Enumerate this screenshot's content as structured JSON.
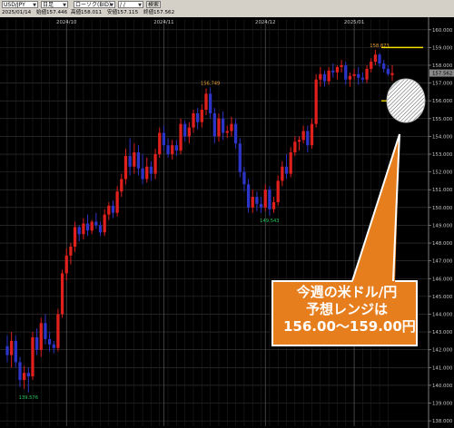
{
  "toolbar": {
    "symbol": "USD/JPY",
    "period": "日足",
    "chart_style": "ローソク(BID)",
    "date_input": "/ /",
    "search_button": "検索"
  },
  "ohlc": {
    "date": "2025/01/14",
    "open_label": "始値",
    "open": "157.446",
    "high_label": "高値",
    "high": "158.011",
    "low_label": "安値",
    "low": "157.115",
    "close_label": "終値",
    "close": "157.562"
  },
  "callout": {
    "line1": "今週の米ドル/円",
    "line2": "予想レンジは",
    "line3": "156.00〜159.00円"
  },
  "colors": {
    "background": "#000000",
    "up_candle": "#e0201c",
    "down_candle": "#2d35c8",
    "grid": "#3a3a3a",
    "axis_text": "#c8c8c8",
    "range_lines": "#f5e000",
    "callout_fill": "#e67e1e",
    "current_price_marker": "#8a8a8a"
  },
  "chart_data": {
    "type": "candlestick",
    "y_axis_ticks": [
      "160.000",
      "159.000",
      "158.000",
      "157.000",
      "156.000",
      "155.000",
      "154.000",
      "153.000",
      "152.000",
      "151.000",
      "150.000",
      "149.000",
      "148.000",
      "147.000",
      "146.000",
      "145.000",
      "144.000",
      "143.000",
      "142.000",
      "141.000",
      "140.000",
      "139.000",
      "138.000"
    ],
    "ylim": [
      137.7,
      160.6
    ],
    "month_labels": [
      {
        "label": "2024/10",
        "index": 14
      },
      {
        "label": "2024/11",
        "index": 37
      },
      {
        "label": "2024/12",
        "index": 61
      },
      {
        "label": "2025/01",
        "index": 82
      }
    ],
    "annotations": [
      {
        "text": "139.576",
        "index": 5,
        "value": 139.576
      },
      {
        "text": "156.749",
        "index": 48,
        "value": 156.749
      },
      {
        "text": "149.543",
        "index": 62,
        "value": 149.543
      },
      {
        "text": "158.873",
        "index": 88,
        "value": 158.873
      }
    ],
    "current_price": "157.562",
    "range_lines": [
      159.0,
      156.0
    ],
    "candles": [
      {
        "o": 142.2,
        "h": 142.8,
        "l": 141.3,
        "c": 141.7
      },
      {
        "o": 141.7,
        "h": 143.0,
        "l": 141.0,
        "c": 142.5
      },
      {
        "o": 142.5,
        "h": 142.8,
        "l": 141.0,
        "c": 141.3
      },
      {
        "o": 141.3,
        "h": 141.6,
        "l": 139.9,
        "c": 140.3
      },
      {
        "o": 140.3,
        "h": 141.1,
        "l": 139.8,
        "c": 140.7
      },
      {
        "o": 140.7,
        "h": 141.0,
        "l": 139.6,
        "c": 140.5
      },
      {
        "o": 140.5,
        "h": 143.0,
        "l": 140.3,
        "c": 142.7
      },
      {
        "o": 142.7,
        "h": 143.2,
        "l": 141.7,
        "c": 142.0
      },
      {
        "o": 142.0,
        "h": 143.8,
        "l": 141.6,
        "c": 143.5
      },
      {
        "o": 143.5,
        "h": 144.0,
        "l": 142.3,
        "c": 142.6
      },
      {
        "o": 142.6,
        "h": 143.0,
        "l": 141.9,
        "c": 142.3
      },
      {
        "o": 142.3,
        "h": 142.5,
        "l": 141.8,
        "c": 142.1
      },
      {
        "o": 142.1,
        "h": 144.3,
        "l": 141.9,
        "c": 144.0
      },
      {
        "o": 144.0,
        "h": 146.5,
        "l": 143.8,
        "c": 146.3
      },
      {
        "o": 146.3,
        "h": 147.7,
        "l": 145.9,
        "c": 147.3
      },
      {
        "o": 147.3,
        "h": 148.0,
        "l": 146.8,
        "c": 147.8
      },
      {
        "o": 147.8,
        "h": 149.2,
        "l": 147.5,
        "c": 148.9
      },
      {
        "o": 148.9,
        "h": 149.0,
        "l": 148.1,
        "c": 148.5
      },
      {
        "o": 148.5,
        "h": 149.4,
        "l": 148.2,
        "c": 149.1
      },
      {
        "o": 149.1,
        "h": 149.6,
        "l": 148.4,
        "c": 148.7
      },
      {
        "o": 148.7,
        "h": 149.3,
        "l": 148.5,
        "c": 149.2
      },
      {
        "o": 149.2,
        "h": 149.7,
        "l": 148.8,
        "c": 149.0
      },
      {
        "o": 149.0,
        "h": 149.2,
        "l": 148.4,
        "c": 148.6
      },
      {
        "o": 148.6,
        "h": 149.9,
        "l": 148.4,
        "c": 149.6
      },
      {
        "o": 149.6,
        "h": 150.3,
        "l": 149.3,
        "c": 150.1
      },
      {
        "o": 150.1,
        "h": 150.4,
        "l": 149.4,
        "c": 149.7
      },
      {
        "o": 149.7,
        "h": 151.2,
        "l": 149.5,
        "c": 150.9
      },
      {
        "o": 150.9,
        "h": 151.9,
        "l": 150.6,
        "c": 151.6
      },
      {
        "o": 151.6,
        "h": 153.3,
        "l": 151.3,
        "c": 152.9
      },
      {
        "o": 152.9,
        "h": 153.9,
        "l": 151.8,
        "c": 152.3
      },
      {
        "o": 152.3,
        "h": 153.6,
        "l": 151.9,
        "c": 153.1
      },
      {
        "o": 153.1,
        "h": 153.5,
        "l": 151.8,
        "c": 152.2
      },
      {
        "o": 152.2,
        "h": 153.0,
        "l": 151.3,
        "c": 151.6
      },
      {
        "o": 151.6,
        "h": 152.8,
        "l": 151.4,
        "c": 152.3
      },
      {
        "o": 152.3,
        "h": 152.6,
        "l": 151.5,
        "c": 151.9
      },
      {
        "o": 151.9,
        "h": 153.3,
        "l": 151.6,
        "c": 153.0
      },
      {
        "o": 153.0,
        "h": 154.5,
        "l": 152.8,
        "c": 154.2
      },
      {
        "o": 154.2,
        "h": 154.6,
        "l": 153.2,
        "c": 153.5
      },
      {
        "o": 153.5,
        "h": 153.9,
        "l": 152.8,
        "c": 153.0
      },
      {
        "o": 153.0,
        "h": 153.8,
        "l": 152.7,
        "c": 153.5
      },
      {
        "o": 153.5,
        "h": 153.8,
        "l": 152.9,
        "c": 153.2
      },
      {
        "o": 153.2,
        "h": 155.0,
        "l": 153.0,
        "c": 154.7
      },
      {
        "o": 154.7,
        "h": 154.9,
        "l": 153.7,
        "c": 154.0
      },
      {
        "o": 154.0,
        "h": 154.8,
        "l": 153.6,
        "c": 154.5
      },
      {
        "o": 154.5,
        "h": 155.5,
        "l": 154.2,
        "c": 155.3
      },
      {
        "o": 155.3,
        "h": 155.6,
        "l": 154.4,
        "c": 154.8
      },
      {
        "o": 154.8,
        "h": 155.8,
        "l": 154.5,
        "c": 155.5
      },
      {
        "o": 155.5,
        "h": 156.7,
        "l": 155.2,
        "c": 156.4
      },
      {
        "o": 156.4,
        "h": 156.749,
        "l": 155.0,
        "c": 155.3
      },
      {
        "o": 155.3,
        "h": 155.6,
        "l": 153.6,
        "c": 154.0
      },
      {
        "o": 154.0,
        "h": 155.3,
        "l": 153.7,
        "c": 155.0
      },
      {
        "o": 155.0,
        "h": 155.4,
        "l": 153.8,
        "c": 154.2
      },
      {
        "o": 154.2,
        "h": 154.6,
        "l": 153.9,
        "c": 154.3
      },
      {
        "o": 154.3,
        "h": 155.1,
        "l": 154.0,
        "c": 154.7
      },
      {
        "o": 154.7,
        "h": 155.0,
        "l": 153.3,
        "c": 153.6
      },
      {
        "o": 153.6,
        "h": 153.9,
        "l": 151.7,
        "c": 152.0
      },
      {
        "o": 152.0,
        "h": 152.3,
        "l": 150.9,
        "c": 151.3
      },
      {
        "o": 151.3,
        "h": 151.6,
        "l": 149.7,
        "c": 150.0
      },
      {
        "o": 150.0,
        "h": 151.0,
        "l": 149.7,
        "c": 150.6
      },
      {
        "o": 150.6,
        "h": 150.9,
        "l": 149.8,
        "c": 150.2
      },
      {
        "o": 150.2,
        "h": 150.6,
        "l": 149.7,
        "c": 150.0
      },
      {
        "o": 150.0,
        "h": 151.3,
        "l": 149.8,
        "c": 151.0
      },
      {
        "o": 151.0,
        "h": 151.2,
        "l": 149.543,
        "c": 149.9
      },
      {
        "o": 149.9,
        "h": 150.6,
        "l": 149.7,
        "c": 150.3
      },
      {
        "o": 150.3,
        "h": 151.8,
        "l": 150.1,
        "c": 151.5
      },
      {
        "o": 151.5,
        "h": 152.6,
        "l": 151.2,
        "c": 152.3
      },
      {
        "o": 152.3,
        "h": 153.0,
        "l": 151.6,
        "c": 151.9
      },
      {
        "o": 151.9,
        "h": 153.4,
        "l": 151.7,
        "c": 153.1
      },
      {
        "o": 153.1,
        "h": 154.0,
        "l": 152.9,
        "c": 153.7
      },
      {
        "o": 153.7,
        "h": 154.0,
        "l": 153.2,
        "c": 153.8
      },
      {
        "o": 153.8,
        "h": 154.6,
        "l": 153.6,
        "c": 154.3
      },
      {
        "o": 154.3,
        "h": 154.6,
        "l": 153.1,
        "c": 153.5
      },
      {
        "o": 153.5,
        "h": 155.0,
        "l": 153.3,
        "c": 154.7
      },
      {
        "o": 154.7,
        "h": 157.5,
        "l": 154.5,
        "c": 157.2
      },
      {
        "o": 157.2,
        "h": 157.9,
        "l": 156.8,
        "c": 157.5
      },
      {
        "o": 157.5,
        "h": 157.7,
        "l": 156.8,
        "c": 157.1
      },
      {
        "o": 157.1,
        "h": 157.9,
        "l": 156.9,
        "c": 157.7
      },
      {
        "o": 157.7,
        "h": 158.1,
        "l": 157.3,
        "c": 157.6
      },
      {
        "o": 157.6,
        "h": 158.0,
        "l": 157.2,
        "c": 157.9
      },
      {
        "o": 157.9,
        "h": 158.3,
        "l": 157.6,
        "c": 158.0
      },
      {
        "o": 158.0,
        "h": 158.2,
        "l": 156.9,
        "c": 157.2
      },
      {
        "o": 157.2,
        "h": 157.6,
        "l": 156.8,
        "c": 157.4
      },
      {
        "o": 157.4,
        "h": 157.8,
        "l": 157.2,
        "c": 157.5
      },
      {
        "o": 157.5,
        "h": 157.9,
        "l": 156.9,
        "c": 157.3
      },
      {
        "o": 157.3,
        "h": 157.6,
        "l": 157.0,
        "c": 157.2
      },
      {
        "o": 157.2,
        "h": 158.0,
        "l": 157.0,
        "c": 157.8
      },
      {
        "o": 157.8,
        "h": 158.4,
        "l": 157.6,
        "c": 158.2
      },
      {
        "o": 158.2,
        "h": 158.873,
        "l": 158.0,
        "c": 158.6
      },
      {
        "o": 158.6,
        "h": 158.7,
        "l": 157.9,
        "c": 158.1
      },
      {
        "o": 158.1,
        "h": 158.3,
        "l": 157.6,
        "c": 157.8
      },
      {
        "o": 157.8,
        "h": 158.0,
        "l": 157.4,
        "c": 157.5
      },
      {
        "o": 157.446,
        "h": 158.011,
        "l": 157.115,
        "c": 157.562
      }
    ]
  }
}
